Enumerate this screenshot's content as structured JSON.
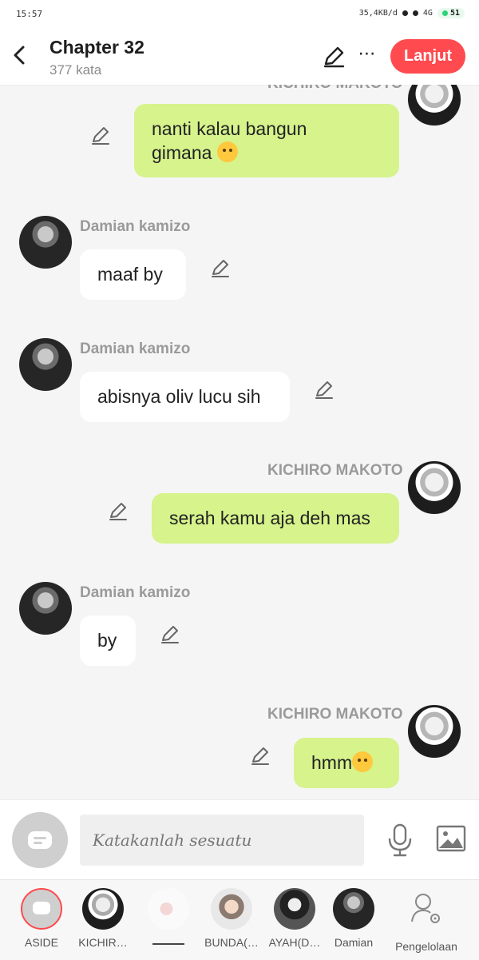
{
  "status_bar": {
    "time": "15:57",
    "network_speed": "35,4KB/d",
    "signal": "4G",
    "battery": "51"
  },
  "header": {
    "title": "Chapter 32",
    "word_count": "377 kata",
    "next_button": "Lanjut"
  },
  "messages": [
    {
      "side": "right",
      "sender": "KICHIRO MAKOTO",
      "line1": "nanti kalau bangun",
      "line2": "gimana",
      "emoji": "tired-face-emoji"
    },
    {
      "side": "left",
      "sender": "Damian kamizo",
      "text": "maaf by"
    },
    {
      "side": "left",
      "sender": "Damian kamizo",
      "text": "abisnya oliv lucu sih"
    },
    {
      "side": "right",
      "sender": "KICHIRO MAKOTO",
      "text": "serah kamu aja deh mas"
    },
    {
      "side": "left",
      "sender": "Damian kamizo",
      "text": "by"
    },
    {
      "side": "right",
      "sender": "KICHIRO MAKOTO",
      "text": "hmm",
      "emoji": "confused-face-emoji"
    }
  ],
  "input": {
    "placeholder": "Katakanlah sesuatu"
  },
  "tabs": [
    {
      "label": "ASIDE",
      "icon": "aside-icon"
    },
    {
      "label": "KICHIR…"
    },
    {
      "label": ""
    },
    {
      "label": "BUNDA(…"
    },
    {
      "label": "AYAH(D…"
    },
    {
      "label": "Damian"
    },
    {
      "label": "Pengelolaan",
      "icon": "manage-user-icon"
    }
  ],
  "colors": {
    "accent": "#ff4a4f",
    "my_bubble": "#d6f38c",
    "other_bubble": "#ffffff",
    "background": "#f5f5f5"
  }
}
